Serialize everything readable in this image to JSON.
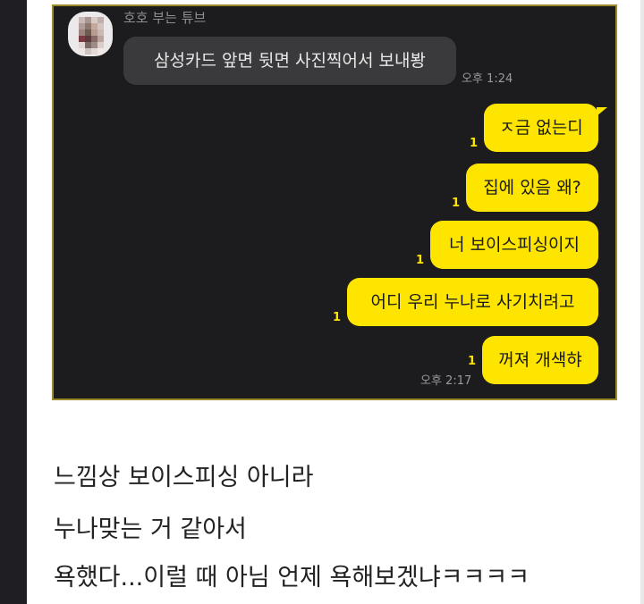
{
  "chat": {
    "sender_name": "호호 부는 튜브",
    "incoming": [
      {
        "text": "삼성카드 앞면 뒷면 사진찍어서 보내봥",
        "time": "오후 1:24"
      }
    ],
    "outgoing": [
      {
        "text": "ㅈ금 없는디",
        "unread": "1"
      },
      {
        "text": "집에 있음 왜?",
        "unread": "1"
      },
      {
        "text": "너 보이스피싱이지",
        "unread": "1"
      },
      {
        "text": "어디 우리 누나로 사기치려고",
        "unread": "1"
      },
      {
        "text": "꺼져 개색햐",
        "unread": "1",
        "time": "오후 2:17"
      }
    ],
    "colors": {
      "background": "#1c1c1e",
      "incoming_bubble": "#3a3a3c",
      "outgoing_bubble": "#fee500",
      "unread": "#fee500"
    }
  },
  "post": {
    "lines": [
      "느낌상 보이스피싱 아니라",
      "누나맞는 거 같아서",
      "욕했다...이럴 때 아님 언제 욕해보겠냐ㅋㅋㅋㅋ"
    ]
  }
}
